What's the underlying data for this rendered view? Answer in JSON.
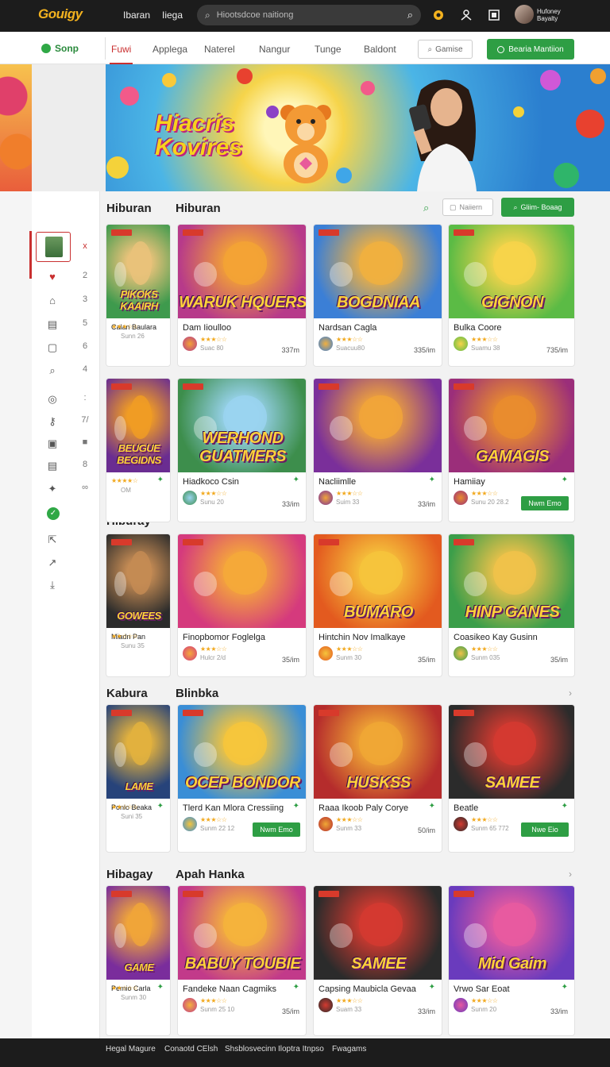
{
  "topbar": {
    "logo_main": "Gouigy",
    "nav": [
      "Ibaran",
      "Iiega"
    ],
    "search_placeholder": "Hiootsdcoe naitiong",
    "user_line1": "Hufoney",
    "user_line2": "Bayalty"
  },
  "navbar": {
    "brand": "Sonp",
    "tabs": [
      "Fuwi",
      "Applega",
      "Naterel",
      "Nangur",
      "Tunge",
      "Baldont"
    ],
    "active_tab": "Fuwi",
    "outline_button": "Gamise",
    "green_button": "Bearia Mantiion"
  },
  "hero": {
    "title_line1": "Hiacris",
    "title_line2": "Kovires"
  },
  "sidebar": {
    "numbers": [
      "x",
      "2",
      "3",
      "5",
      "6",
      "4",
      ":",
      "7/",
      "■",
      "8",
      "∞"
    ]
  },
  "toolbar": {
    "input_placeholder": "Naiiern",
    "button_label": "Gliim- Boaag"
  },
  "sections": [
    {
      "titles": [
        "Hiburan",
        "Hiburan"
      ],
      "cards": [
        {
          "title": "Calan Baulara",
          "art": "PIKOKS KAAIRH",
          "meta": "Sunn 26",
          "size": "",
          "stars": "★★★☆☆",
          "colors": [
            "#3e9a4d",
            "#e9c27a"
          ]
        },
        {
          "title": "Dam Iioulloo",
          "art": "WARUK HQUERS",
          "meta": "Suac 80",
          "size": "337m",
          "stars": "★★★☆☆",
          "colors": [
            "#b73a8a",
            "#f3a335"
          ]
        },
        {
          "title": "Nardsan Cagla",
          "art": "BOGDNIAA",
          "meta": "Suacuu80",
          "size": "335/im",
          "stars": "★★★☆☆",
          "colors": [
            "#3b7fd6",
            "#f0b040"
          ]
        },
        {
          "title": "Bulka Coore",
          "art": "GIGNON",
          "meta": "Suamu 38",
          "size": "735/im",
          "stars": "★★★☆☆",
          "colors": [
            "#5bbb45",
            "#f7d44a"
          ]
        }
      ]
    },
    {
      "titles": [],
      "cards": [
        {
          "title": "",
          "art": "BEUGUE BEGIDNS",
          "meta": "OM",
          "size": "",
          "stars": "★★★★☆",
          "colors": [
            "#6a2d91",
            "#f09c24"
          ]
        },
        {
          "title": "Hiadkoco Csin",
          "art": "WERHOND GUATMERS",
          "meta": "Sunu 20",
          "size": "33/im",
          "stars": "★★★☆☆",
          "colors": [
            "#3d8e4c",
            "#9ad4f0"
          ]
        },
        {
          "title": "Nacliimlle",
          "art": "",
          "meta": "Suim 33",
          "size": "33/im",
          "stars": "★★★☆☆",
          "colors": [
            "#7a2f9a",
            "#f1a53a"
          ]
        },
        {
          "title": "Hamiiay",
          "art": "GAMAGIS",
          "meta": "Sunu 20 28.2",
          "size": "",
          "stars": "★★★☆☆",
          "new": "Nwm Emo",
          "colors": [
            "#9b2e7a",
            "#e98c2e"
          ]
        }
      ]
    },
    {
      "titles": [
        "Hiburay"
      ],
      "cards": [
        {
          "title": "Miadn Pan",
          "art": "GOWEES",
          "meta": "Sunu 35",
          "size": "",
          "stars": "★★☆☆☆",
          "colors": [
            "#2b2b2b",
            "#c48b54"
          ]
        },
        {
          "title": "Finopbomor Foglelga",
          "art": "",
          "meta": "Hulcr 2/d",
          "size": "35/im",
          "stars": "★★★☆☆",
          "colors": [
            "#d53a7d",
            "#f5a93a"
          ]
        },
        {
          "title": "Hintchin Nov Imalkaye",
          "art": "BUMARO",
          "meta": "Sunm 30",
          "size": "35/im",
          "stars": "★★★☆☆",
          "colors": [
            "#e35a1f",
            "#f6c43c"
          ]
        },
        {
          "title": "Coasikeo Kay Gusinn",
          "art": "HINP GANES",
          "meta": "Sunm 035",
          "size": "35/im",
          "stars": "★★★☆☆",
          "colors": [
            "#3b9e4a",
            "#f0c24a"
          ]
        }
      ]
    },
    {
      "titles": [
        "Kabura",
        "Blinbka"
      ],
      "cards": [
        {
          "title": "Ponlo Beaka",
          "art": "LAME",
          "meta": "Suni 35",
          "size": "",
          "stars": "★★☆☆☆",
          "colors": [
            "#27437a",
            "#e2b13e"
          ]
        },
        {
          "title": "Tlerd Kan Mlora Cressiing",
          "art": "OCEP BONDOR",
          "meta": "Sunm 22 12",
          "size": "",
          "stars": "★★★☆☆",
          "new": "Nwm Emo",
          "colors": [
            "#3a8ed6",
            "#f6c53c"
          ]
        },
        {
          "title": "Raaa Ikoob Paly Corye",
          "art": "HUSKSS",
          "meta": "Sunm 33",
          "size": "50/im",
          "stars": "★★★☆☆",
          "colors": [
            "#b52c2c",
            "#f0a735"
          ]
        },
        {
          "title": "Beatle",
          "art": "SAMEE",
          "meta": "Sunm 65 772",
          "size": "",
          "stars": "★★★☆☆",
          "new": "Nwe Eio",
          "colors": [
            "#2b2b2b",
            "#d43a30"
          ]
        }
      ]
    },
    {
      "titles": [
        "Hibagay",
        "Apah Hanka"
      ],
      "cards": [
        {
          "title": "Pemio Carla",
          "art": "GAME",
          "meta": "Sunm 30",
          "size": "",
          "stars": "★★☆☆☆",
          "colors": [
            "#7a2d9c",
            "#f0a53a"
          ]
        },
        {
          "title": "Fandeke Naan Cagmiks",
          "art": "BABUY TOUBIE",
          "meta": "Sunm 25 10",
          "size": "35/im",
          "stars": "★★★☆☆",
          "colors": [
            "#c23a8a",
            "#f5b33c"
          ]
        },
        {
          "title": "Capsing Maubicla Gevaa",
          "art": "SAMEE",
          "meta": "Suam 33",
          "size": "33/im",
          "stars": "★★★☆☆",
          "colors": [
            "#2b2b2b",
            "#d43a30"
          ]
        },
        {
          "title": "Vrwo Sar Eoat",
          "art": "Mid Gaim",
          "meta": "Sunm 20",
          "size": "33/im",
          "stars": "★★★☆☆",
          "colors": [
            "#6a3bbd",
            "#e75aa0"
          ]
        }
      ]
    }
  ],
  "footer": {
    "items": [
      "Hegal Magure",
      "Conaotd CElsh",
      "Shsblosvecinn",
      "Iloptra Itnpso",
      "Fwagams"
    ]
  }
}
